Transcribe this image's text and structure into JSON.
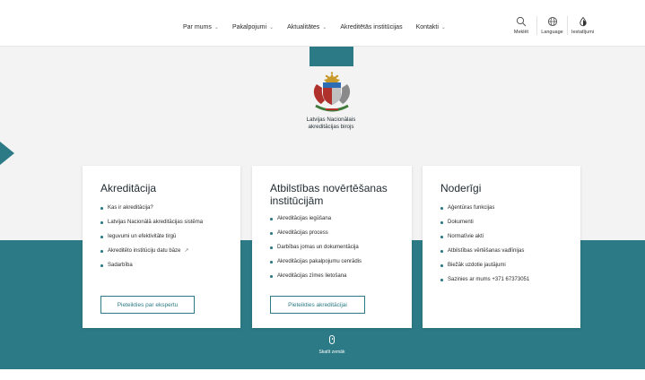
{
  "nav": {
    "items": [
      {
        "label": "Par mums",
        "has_dropdown": true
      },
      {
        "label": "Pakalpojumi",
        "has_dropdown": true
      },
      {
        "label": "Aktualitātes",
        "has_dropdown": true
      },
      {
        "label": "Akreditētās institūcijas",
        "has_dropdown": false
      },
      {
        "label": "Kontakti",
        "has_dropdown": true
      }
    ],
    "chevron": "⌄"
  },
  "tools": {
    "search_label": "Meklēt",
    "language_label": "Language",
    "accessibility_label": "Iestatījumi"
  },
  "hero": {
    "org_name_line1": "Latvijas Nacionālais",
    "org_name_line2": "akreditācijas birojs"
  },
  "cards": [
    {
      "title": "Akreditācija",
      "items": [
        "Kas ir akreditācija?",
        "Latvijas Nacionālā akreditācijas sistēma",
        "Ieguvumi un efektivitāte tirgū",
        "Akreditēto institūciju datu bāze",
        "Sadarbība"
      ],
      "button": "Pieteikties par ekspertu"
    },
    {
      "title": "Atbilstības novērtēšanas institūcijām",
      "items": [
        "Akreditācijas iegūšana",
        "Akreditācijas process",
        "Darbības jomas un dokumentācija",
        "Akreditācijas pakalpojumu cenrādis",
        "Akreditācijas zīmes lietošana"
      ],
      "button": "Pieteikties akreditācijai"
    },
    {
      "title": "Noderīgi",
      "items": [
        "Aģentūras funkcijas",
        "Dokumenti",
        "Normatīvie akti",
        "Atbilstības vērtēšanas vadlīnijas",
        "Biežāk uzdotie jautājumi",
        "Sazinies ar mums +371 67373051"
      ]
    }
  ],
  "scroll_hint": "Skatīt zemāk",
  "colors": {
    "accent": "#2c7a86",
    "hero_bg": "#f3f3f3"
  }
}
